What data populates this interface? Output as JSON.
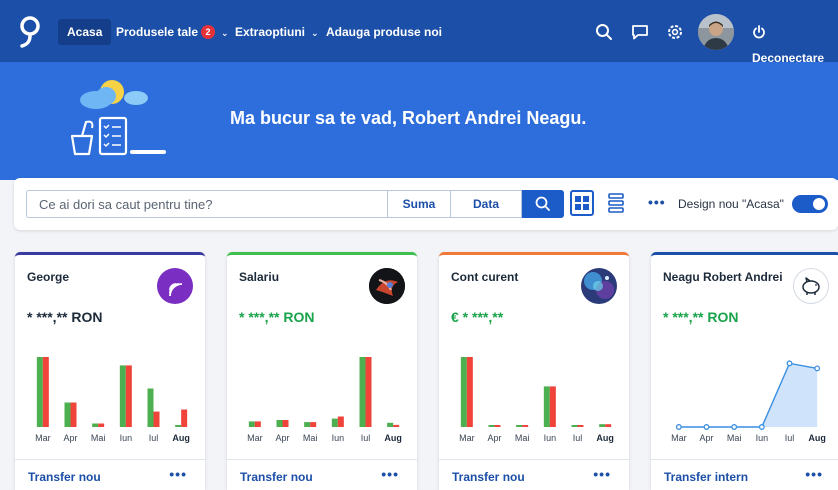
{
  "nav": {
    "home": "Acasa",
    "products": "Produsele tale",
    "products_badge": "2",
    "extras": "Extraoptiuni",
    "add_products": "Adauga produse noi",
    "logout": "Deconectare"
  },
  "hero": {
    "greeting": "Ma bucur sa te vad,  Robert Andrei Neagu."
  },
  "search": {
    "placeholder": "Ce ai dori sa caut pentru tine?",
    "amount_label": "Suma",
    "date_label": "Data",
    "toggle_label": "Design nou \"Acasa\"",
    "toggle_on": true
  },
  "colors": {
    "nav": "#1c4fa8",
    "hero": "#2d6edc",
    "accent": "#1c5cc8",
    "income_bar": "#4caf50",
    "expense_bar": "#f0443a",
    "positive_amount": "#19a34a"
  },
  "cards": [
    {
      "title": "George",
      "amount": "* ***,** RON",
      "amount_color": "#1c2a3a",
      "accent": "#3a3aa0",
      "icon": "nfc-icon",
      "footer_link": "Transfer nou",
      "chart_data": {
        "type": "bar",
        "categories": [
          "Mar",
          "Apr",
          "Mai",
          "Iun",
          "Iul",
          "Aug"
        ],
        "highlight_category": "Aug",
        "series": [
          {
            "values": [
              100,
              35,
              5,
              88,
              55,
              2
            ]
          },
          {
            "values": [
              100,
              35,
              5,
              88,
              22,
              25
            ]
          }
        ],
        "ylim": [
          0,
          100
        ]
      }
    },
    {
      "title": "Salariu",
      "amount": "* ***,** RON",
      "amount_color": "#19a34a",
      "accent": "#3fbf4f",
      "icon": "abstract-avatar-icon",
      "footer_link": "Transfer nou",
      "chart_data": {
        "type": "bar",
        "categories": [
          "Mar",
          "Apr",
          "Mai",
          "Iun",
          "Iul",
          "Aug"
        ],
        "highlight_category": "Aug",
        "series": [
          {
            "values": [
              8,
              10,
              7,
              12,
              100,
              6
            ]
          },
          {
            "values": [
              8,
              10,
              7,
              15,
              100,
              3
            ]
          }
        ],
        "ylim": [
          0,
          100
        ]
      }
    },
    {
      "title": "Cont curent",
      "amount": "€ * ***,**",
      "amount_color": "#19a34a",
      "accent": "#f07a3a",
      "icon": "galaxy-avatar-icon",
      "footer_link": "Transfer nou",
      "chart_data": {
        "type": "bar",
        "categories": [
          "Mar",
          "Apr",
          "Mai",
          "Iun",
          "Iul",
          "Aug"
        ],
        "highlight_category": "Aug",
        "series": [
          {
            "values": [
              100,
              2,
              2,
              58,
              2,
              4
            ]
          },
          {
            "values": [
              100,
              2,
              2,
              58,
              2,
              4
            ]
          }
        ],
        "ylim": [
          0,
          100
        ]
      }
    },
    {
      "title": "Neagu Robert Andrei",
      "amount": "* ***,** RON",
      "amount_color": "#19a34a",
      "accent": "#1c4fa8",
      "icon": "piggy-bank-icon",
      "footer_link": "Transfer intern",
      "chart_data": {
        "type": "area",
        "categories": [
          "Mar",
          "Apr",
          "Mai",
          "Iun",
          "Iul",
          "Aug"
        ],
        "highlight_category": "Aug",
        "series": [
          {
            "values": [
              0,
              0,
              0,
              0,
              100,
              92
            ]
          }
        ],
        "ylim": [
          0,
          110
        ]
      }
    }
  ]
}
